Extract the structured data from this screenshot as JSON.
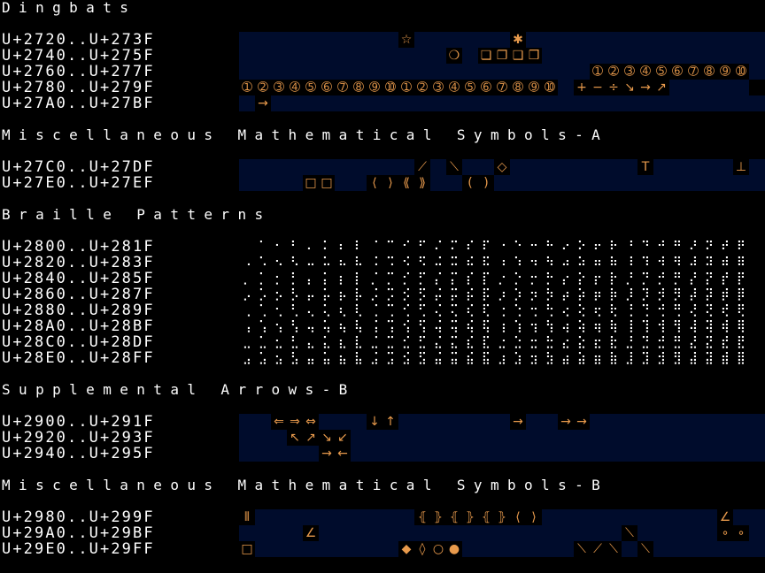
{
  "colors": {
    "background": "#000000",
    "band": "#000c2c",
    "glyph": "#e89a4c",
    "text": "#ffffff"
  },
  "sections": [
    {
      "title": "Dingbats",
      "rows": [
        {
          "label": "U+2720..U+273F",
          "glyphs": [
            [
              10,
              "☆"
            ],
            [
              17,
              "✱"
            ]
          ]
        },
        {
          "label": "U+2740..U+275F",
          "glyphs": [
            [
              13,
              "❍"
            ],
            [
              15,
              "❏"
            ],
            [
              16,
              "❐"
            ],
            [
              17,
              "❑"
            ],
            [
              18,
              "❒"
            ]
          ]
        },
        {
          "label": "U+2760..U+277F",
          "glyphs": [
            [
              22,
              "➀"
            ],
            [
              23,
              "➁"
            ],
            [
              24,
              "➂"
            ],
            [
              25,
              "➃"
            ],
            [
              26,
              "➄"
            ],
            [
              27,
              "➅"
            ],
            [
              28,
              "➆"
            ],
            [
              29,
              "➇"
            ],
            [
              30,
              "➈"
            ],
            [
              31,
              "➉"
            ]
          ]
        },
        {
          "label": "U+2780..U+279F",
          "glyphs": [
            [
              0,
              "➀"
            ],
            [
              1,
              "➁"
            ],
            [
              2,
              "➂"
            ],
            [
              3,
              "➃"
            ],
            [
              4,
              "➄"
            ],
            [
              5,
              "➅"
            ],
            [
              6,
              "➆"
            ],
            [
              7,
              "➇"
            ],
            [
              8,
              "➈"
            ],
            [
              9,
              "➉"
            ],
            [
              10,
              "➀"
            ],
            [
              11,
              "➁"
            ],
            [
              12,
              "➂"
            ],
            [
              13,
              "➃"
            ],
            [
              14,
              "➄"
            ],
            [
              15,
              "➅"
            ],
            [
              16,
              "➆"
            ],
            [
              17,
              "➇"
            ],
            [
              18,
              "➈"
            ],
            [
              19,
              "➉"
            ],
            [
              21,
              "+"
            ],
            [
              22,
              "−"
            ],
            [
              23,
              "÷"
            ],
            [
              24,
              "↘"
            ],
            [
              25,
              "→"
            ],
            [
              26,
              "↗"
            ],
            [
              32,
              ""
            ]
          ]
        },
        {
          "label": "U+27A0..U+27BF",
          "glyphs": [
            [
              1,
              "→"
            ]
          ]
        }
      ]
    },
    {
      "title": "Miscellaneous Mathematical Symbols-A",
      "rows": [
        {
          "label": "U+27C0..U+27DF",
          "glyphs": [
            [
              11,
              "⟋"
            ],
            [
              13,
              "⟍"
            ],
            [
              16,
              "◇"
            ],
            [
              25,
              "T"
            ],
            [
              31,
              "⊥"
            ]
          ]
        },
        {
          "label": "U+27E0..U+27EF",
          "glyphs": [
            [
              4,
              "□"
            ],
            [
              5,
              "□"
            ],
            [
              8,
              "⟨"
            ],
            [
              9,
              "⟩"
            ],
            [
              10,
              "⟪"
            ],
            [
              11,
              "⟫"
            ],
            [
              14,
              "("
            ],
            [
              15,
              ")"
            ]
          ]
        }
      ]
    },
    {
      "title": "Braille Patterns",
      "rows": [
        {
          "label": "U+2800..U+281F",
          "range": 10240
        },
        {
          "label": "U+2820..U+283F",
          "range": 10272
        },
        {
          "label": "U+2840..U+285F",
          "range": 10304
        },
        {
          "label": "U+2860..U+287F",
          "range": 10336
        },
        {
          "label": "U+2880..U+289F",
          "range": 10368
        },
        {
          "label": "U+28A0..U+28BF",
          "range": 10400
        },
        {
          "label": "U+28C0..U+28DF",
          "range": 10432
        },
        {
          "label": "U+28E0..U+28FF",
          "range": 10464
        }
      ]
    },
    {
      "title": "Supplemental Arrows-B",
      "rows": [
        {
          "label": "U+2900..U+291F",
          "glyphs": [
            [
              2,
              "⇐"
            ],
            [
              3,
              "⇒"
            ],
            [
              4,
              "⇔"
            ],
            [
              8,
              "↓"
            ],
            [
              9,
              "↑"
            ],
            [
              17,
              "→"
            ],
            [
              20,
              "→"
            ],
            [
              21,
              "→"
            ]
          ]
        },
        {
          "label": "U+2920..U+293F",
          "glyphs": [
            [
              3,
              "↖"
            ],
            [
              4,
              "↗"
            ],
            [
              5,
              "↘"
            ],
            [
              6,
              "↙"
            ]
          ]
        },
        {
          "label": "U+2940..U+295F",
          "glyphs": [
            [
              5,
              "→"
            ],
            [
              6,
              "←"
            ]
          ]
        }
      ]
    },
    {
      "title": "Miscellaneous Mathematical Symbols-B",
      "rows": [
        {
          "label": "U+2980..U+299F",
          "glyphs": [
            [
              0,
              "⦀"
            ],
            [
              11,
              "⦃"
            ],
            [
              12,
              "⦄"
            ],
            [
              13,
              "⦃"
            ],
            [
              14,
              "⦄"
            ],
            [
              15,
              "⦃"
            ],
            [
              16,
              "⦄"
            ],
            [
              17,
              "⟨"
            ],
            [
              18,
              "⟩"
            ],
            [
              30,
              "∠"
            ]
          ]
        },
        {
          "label": "U+29A0..U+29BF",
          "glyphs": [
            [
              4,
              "∠"
            ],
            [
              24,
              "⟍"
            ],
            [
              30,
              "∘"
            ],
            [
              31,
              "∘"
            ]
          ]
        },
        {
          "label": "U+29E0..U+29FF",
          "glyphs": [
            [
              0,
              "□"
            ],
            [
              10,
              "◆"
            ],
            [
              11,
              "◊"
            ],
            [
              12,
              "○"
            ],
            [
              13,
              "●"
            ],
            [
              21,
              "⟍"
            ],
            [
              22,
              "⟋"
            ],
            [
              23,
              "⟍"
            ],
            [
              25,
              "⟍"
            ]
          ]
        }
      ]
    }
  ]
}
